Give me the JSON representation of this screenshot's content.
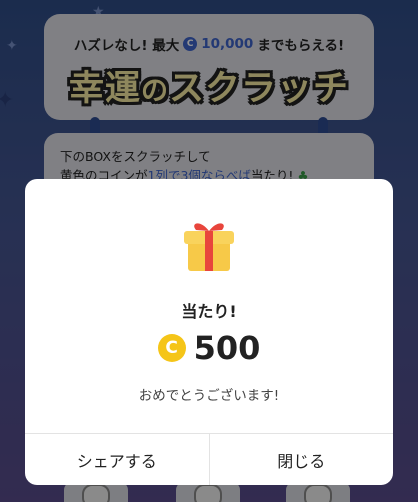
{
  "banner": {
    "subtitle_prefix": "ハズレなし! 最大",
    "coin_symbol": "C",
    "max_amount": "10,000",
    "subtitle_suffix": "までもらえる!",
    "title_part1": "幸運",
    "title_part2": "の",
    "title_part3": "スクラッチ"
  },
  "instructions": {
    "line1": "下のBOXをスクラッチして",
    "line2_prefix": "黄色のコインが",
    "line2_highlight": "1列で3個ならべば",
    "line2_suffix": "当たり!"
  },
  "modal": {
    "icon": "gift-icon",
    "title": "当たり!",
    "coin_symbol": "C",
    "amount": "500",
    "message": "おめでとうございます!",
    "share_label": "シェアする",
    "close_label": "閉じる"
  },
  "colors": {
    "accent_blue": "#3d62c9",
    "coin_yellow": "#f5c518",
    "gift_yellow": "#f7c948",
    "ribbon_red": "#e8453c"
  }
}
